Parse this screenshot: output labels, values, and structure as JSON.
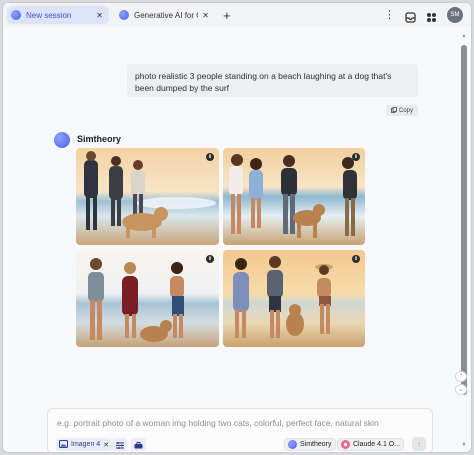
{
  "tabs": [
    {
      "label": "New session",
      "active": true
    },
    {
      "label": "Generative AI for G...",
      "active": false
    }
  ],
  "tabbar": {
    "new_tab": "+",
    "menu": "⋮",
    "avatar_initials": "SM"
  },
  "chat": {
    "user_prompt": "photo realistic 3 people standing on a beach laughing at a dog that's been dumped by the surf",
    "copy_label": "Copy",
    "assistant_name": "Simtheory",
    "images": [
      {
        "name": "generated-image-1",
        "icon": "download-icon"
      },
      {
        "name": "generated-image-2",
        "icon": "download-icon"
      },
      {
        "name": "generated-image-3",
        "icon": "download-icon"
      },
      {
        "name": "generated-image-4",
        "icon": "download-icon"
      }
    ]
  },
  "composer": {
    "placeholder": "e.g. portrait photo of a woman img holding two cats, colorful, perfect face, natural skin",
    "tool_chip": "Imagen 4",
    "assistant_chip": "Simtheory",
    "model_chip": "Claude 4.1 O..."
  },
  "colors": {
    "accent": "#3852d6",
    "active_tab_bg": "#dde3f8"
  }
}
